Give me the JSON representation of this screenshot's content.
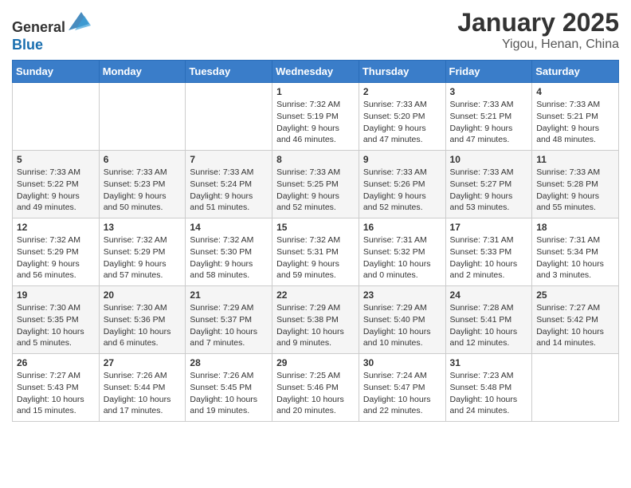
{
  "header": {
    "logo_line1": "General",
    "logo_line2": "Blue",
    "title": "January 2025",
    "subtitle": "Yigou, Henan, China"
  },
  "days_of_week": [
    "Sunday",
    "Monday",
    "Tuesday",
    "Wednesday",
    "Thursday",
    "Friday",
    "Saturday"
  ],
  "weeks": [
    [
      {
        "day": "",
        "text": ""
      },
      {
        "day": "",
        "text": ""
      },
      {
        "day": "",
        "text": ""
      },
      {
        "day": "1",
        "text": "Sunrise: 7:32 AM\nSunset: 5:19 PM\nDaylight: 9 hours and 46 minutes."
      },
      {
        "day": "2",
        "text": "Sunrise: 7:33 AM\nSunset: 5:20 PM\nDaylight: 9 hours and 47 minutes."
      },
      {
        "day": "3",
        "text": "Sunrise: 7:33 AM\nSunset: 5:21 PM\nDaylight: 9 hours and 47 minutes."
      },
      {
        "day": "4",
        "text": "Sunrise: 7:33 AM\nSunset: 5:21 PM\nDaylight: 9 hours and 48 minutes."
      }
    ],
    [
      {
        "day": "5",
        "text": "Sunrise: 7:33 AM\nSunset: 5:22 PM\nDaylight: 9 hours and 49 minutes."
      },
      {
        "day": "6",
        "text": "Sunrise: 7:33 AM\nSunset: 5:23 PM\nDaylight: 9 hours and 50 minutes."
      },
      {
        "day": "7",
        "text": "Sunrise: 7:33 AM\nSunset: 5:24 PM\nDaylight: 9 hours and 51 minutes."
      },
      {
        "day": "8",
        "text": "Sunrise: 7:33 AM\nSunset: 5:25 PM\nDaylight: 9 hours and 52 minutes."
      },
      {
        "day": "9",
        "text": "Sunrise: 7:33 AM\nSunset: 5:26 PM\nDaylight: 9 hours and 52 minutes."
      },
      {
        "day": "10",
        "text": "Sunrise: 7:33 AM\nSunset: 5:27 PM\nDaylight: 9 hours and 53 minutes."
      },
      {
        "day": "11",
        "text": "Sunrise: 7:33 AM\nSunset: 5:28 PM\nDaylight: 9 hours and 55 minutes."
      }
    ],
    [
      {
        "day": "12",
        "text": "Sunrise: 7:32 AM\nSunset: 5:29 PM\nDaylight: 9 hours and 56 minutes."
      },
      {
        "day": "13",
        "text": "Sunrise: 7:32 AM\nSunset: 5:29 PM\nDaylight: 9 hours and 57 minutes."
      },
      {
        "day": "14",
        "text": "Sunrise: 7:32 AM\nSunset: 5:30 PM\nDaylight: 9 hours and 58 minutes."
      },
      {
        "day": "15",
        "text": "Sunrise: 7:32 AM\nSunset: 5:31 PM\nDaylight: 9 hours and 59 minutes."
      },
      {
        "day": "16",
        "text": "Sunrise: 7:31 AM\nSunset: 5:32 PM\nDaylight: 10 hours and 0 minutes."
      },
      {
        "day": "17",
        "text": "Sunrise: 7:31 AM\nSunset: 5:33 PM\nDaylight: 10 hours and 2 minutes."
      },
      {
        "day": "18",
        "text": "Sunrise: 7:31 AM\nSunset: 5:34 PM\nDaylight: 10 hours and 3 minutes."
      }
    ],
    [
      {
        "day": "19",
        "text": "Sunrise: 7:30 AM\nSunset: 5:35 PM\nDaylight: 10 hours and 5 minutes."
      },
      {
        "day": "20",
        "text": "Sunrise: 7:30 AM\nSunset: 5:36 PM\nDaylight: 10 hours and 6 minutes."
      },
      {
        "day": "21",
        "text": "Sunrise: 7:29 AM\nSunset: 5:37 PM\nDaylight: 10 hours and 7 minutes."
      },
      {
        "day": "22",
        "text": "Sunrise: 7:29 AM\nSunset: 5:38 PM\nDaylight: 10 hours and 9 minutes."
      },
      {
        "day": "23",
        "text": "Sunrise: 7:29 AM\nSunset: 5:40 PM\nDaylight: 10 hours and 10 minutes."
      },
      {
        "day": "24",
        "text": "Sunrise: 7:28 AM\nSunset: 5:41 PM\nDaylight: 10 hours and 12 minutes."
      },
      {
        "day": "25",
        "text": "Sunrise: 7:27 AM\nSunset: 5:42 PM\nDaylight: 10 hours and 14 minutes."
      }
    ],
    [
      {
        "day": "26",
        "text": "Sunrise: 7:27 AM\nSunset: 5:43 PM\nDaylight: 10 hours and 15 minutes."
      },
      {
        "day": "27",
        "text": "Sunrise: 7:26 AM\nSunset: 5:44 PM\nDaylight: 10 hours and 17 minutes."
      },
      {
        "day": "28",
        "text": "Sunrise: 7:26 AM\nSunset: 5:45 PM\nDaylight: 10 hours and 19 minutes."
      },
      {
        "day": "29",
        "text": "Sunrise: 7:25 AM\nSunset: 5:46 PM\nDaylight: 10 hours and 20 minutes."
      },
      {
        "day": "30",
        "text": "Sunrise: 7:24 AM\nSunset: 5:47 PM\nDaylight: 10 hours and 22 minutes."
      },
      {
        "day": "31",
        "text": "Sunrise: 7:23 AM\nSunset: 5:48 PM\nDaylight: 10 hours and 24 minutes."
      },
      {
        "day": "",
        "text": ""
      }
    ]
  ]
}
